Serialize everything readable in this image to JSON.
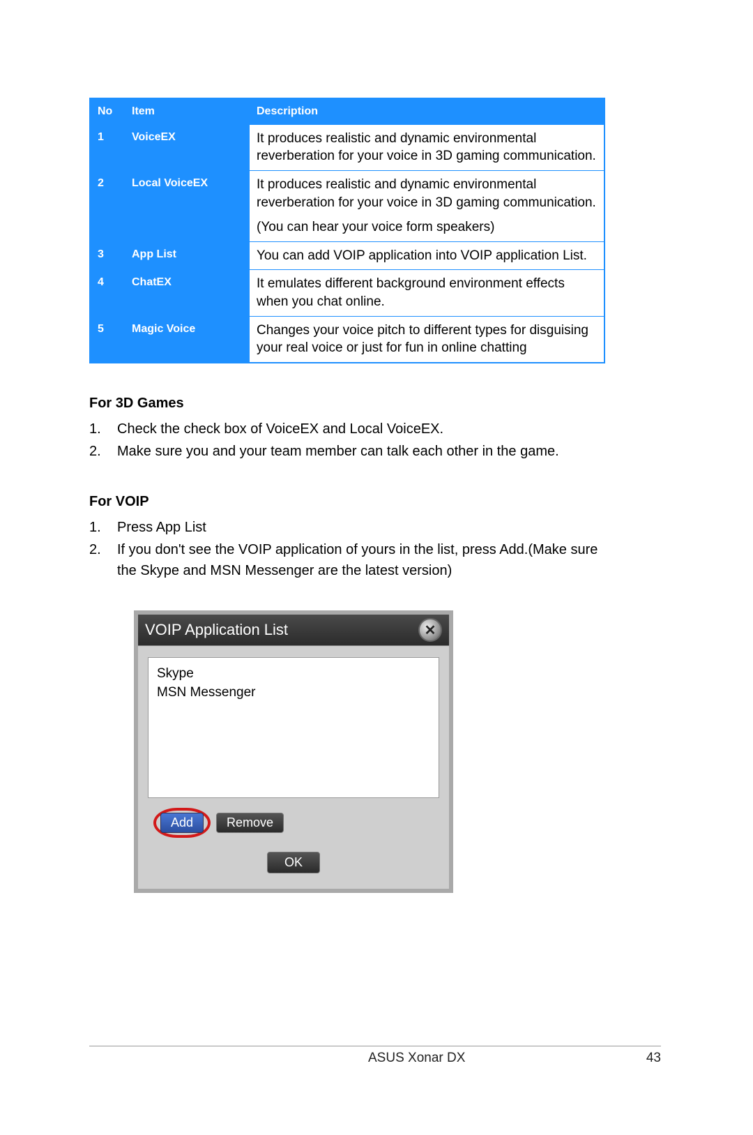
{
  "table": {
    "headers": {
      "no": "No",
      "item": "Item",
      "desc": "Description"
    },
    "rows": [
      {
        "no": "1",
        "item": "VoiceEX",
        "desc": "It produces realistic and dynamic environmental reverberation for your voice in 3D gaming communication."
      },
      {
        "no": "2",
        "item": "Local VoiceEX",
        "desc": "It produces realistic and dynamic environmental reverberation for your voice in 3D gaming communication.\n(You can hear your voice form speakers)"
      },
      {
        "no": "3",
        "item": "App List",
        "desc": "You can add VOIP application into VOIP application List."
      },
      {
        "no": "4",
        "item": "ChatEX",
        "desc": "It emulates different background environment effects when you chat online."
      },
      {
        "no": "5",
        "item": "Magic Voice",
        "desc": "Changes your voice pitch to different types for disguising your real voice or just for fun in online chatting"
      }
    ]
  },
  "sections": {
    "games_title": "For 3D Games",
    "games_steps": [
      "Check the check box of VoiceEX and Local VoiceEX.",
      "Make sure you and your team member can talk each other in the game."
    ],
    "voip_title": "For VOIP",
    "voip_steps": [
      "Press App List",
      "If you don't see the VOIP application of yours in the list, press Add.(Make sure the Skype and MSN Messenger are the latest version)"
    ]
  },
  "dialog": {
    "title": "VOIP Application List",
    "items": [
      "Skype",
      "MSN Messenger"
    ],
    "buttons": {
      "add": "Add",
      "remove": "Remove",
      "ok": "OK"
    }
  },
  "footer": {
    "product": "ASUS Xonar DX",
    "page": "43"
  }
}
